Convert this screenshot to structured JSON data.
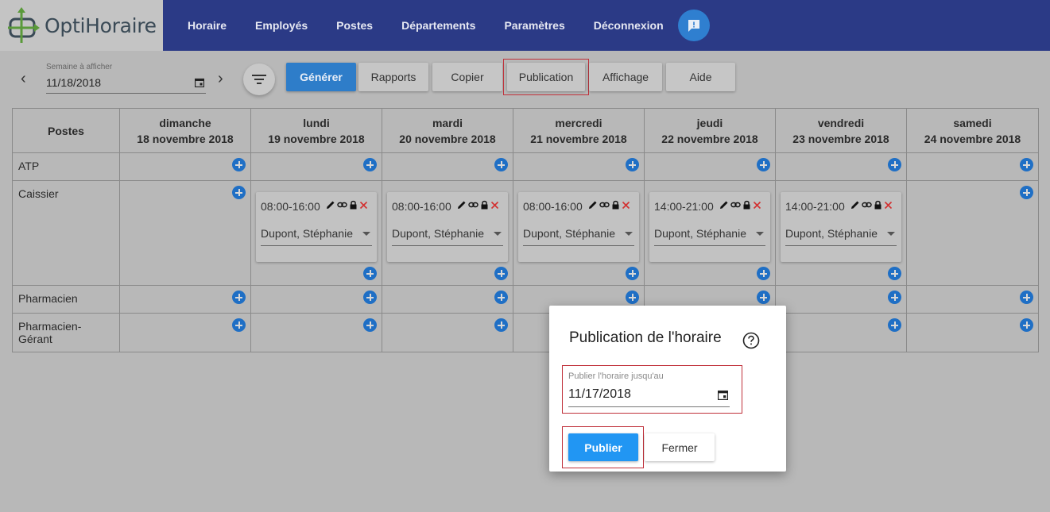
{
  "app": {
    "logo_text": "OptiHoraire"
  },
  "nav": {
    "items": [
      {
        "label": "Horaire"
      },
      {
        "label": "Employés"
      },
      {
        "label": "Postes"
      },
      {
        "label": "Départements"
      },
      {
        "label": "Paramètres"
      },
      {
        "label": "Déconnexion"
      }
    ],
    "chat_icon": "chat-alert-icon"
  },
  "toolbar": {
    "week_label": "Semaine à afficher",
    "week_value": "11/18/2018",
    "buttons": {
      "generate": "Générer",
      "reports": "Rapports",
      "copy": "Copier",
      "publication": "Publication",
      "display": "Affichage",
      "help": "Aide"
    }
  },
  "schedule": {
    "header_postes": "Postes",
    "days": [
      {
        "name": "dimanche",
        "date": "18 novembre 2018"
      },
      {
        "name": "lundi",
        "date": "19 novembre 2018"
      },
      {
        "name": "mardi",
        "date": "20 novembre 2018"
      },
      {
        "name": "mercredi",
        "date": "21 novembre 2018"
      },
      {
        "name": "jeudi",
        "date": "22 novembre 2018"
      },
      {
        "name": "vendredi",
        "date": "23 novembre 2018"
      },
      {
        "name": "samedi",
        "date": "24 novembre 2018"
      }
    ],
    "positions": [
      "ATP",
      "Caissier",
      "Pharmacien",
      "Pharmacien-Gérant"
    ],
    "shifts": [
      {
        "time": "08:00-16:00",
        "employee": "Dupont, Stéphanie"
      },
      {
        "time": "08:00-16:00",
        "employee": "Dupont, Stéphanie"
      },
      {
        "time": "08:00-16:00",
        "employee": "Dupont, Stéphanie"
      },
      {
        "time": "14:00-21:00",
        "employee": "Dupont, Stéphanie"
      },
      {
        "time": "14:00-21:00",
        "employee": "Dupont, Stéphanie"
      }
    ]
  },
  "modal": {
    "title": "Publication de l'horaire",
    "date_label": "Publier l'horaire jusqu'au",
    "date_value": "11/17/2018",
    "publish_label": "Publier",
    "close_label": "Fermer"
  },
  "colors": {
    "navbar": "#2b3a86",
    "primary": "#2196f3",
    "highlight": "#c0303a",
    "delete": "#d32f2f"
  }
}
